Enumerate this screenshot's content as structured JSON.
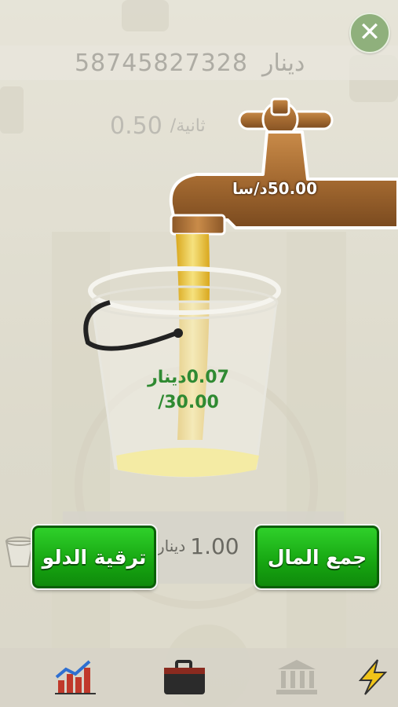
{
  "header": {
    "balance_value": "58745827328",
    "balance_unit": "دينار"
  },
  "rate_second": {
    "value": "0.50",
    "unit": "/ثانية"
  },
  "faucet": {
    "rate_hour_label": "50.00د/سا"
  },
  "bucket": {
    "current": "0.07دينار",
    "capacity": "/30.00"
  },
  "price": {
    "value": "1.00",
    "unit": "دينار"
  },
  "buttons": {
    "upgrade_label": "ترقية الدلو",
    "collect_label": "جمع المال"
  },
  "close_symbol": "✕",
  "icons": {
    "close": "close-icon",
    "chart": "chart-icon",
    "briefcase": "briefcase-icon",
    "bank": "bank-icon",
    "lightning": "lightning-icon"
  },
  "colors": {
    "button_green": "#16a511",
    "bucket_text": "#2f8a32",
    "faucet_copper": "#b97c3c"
  }
}
